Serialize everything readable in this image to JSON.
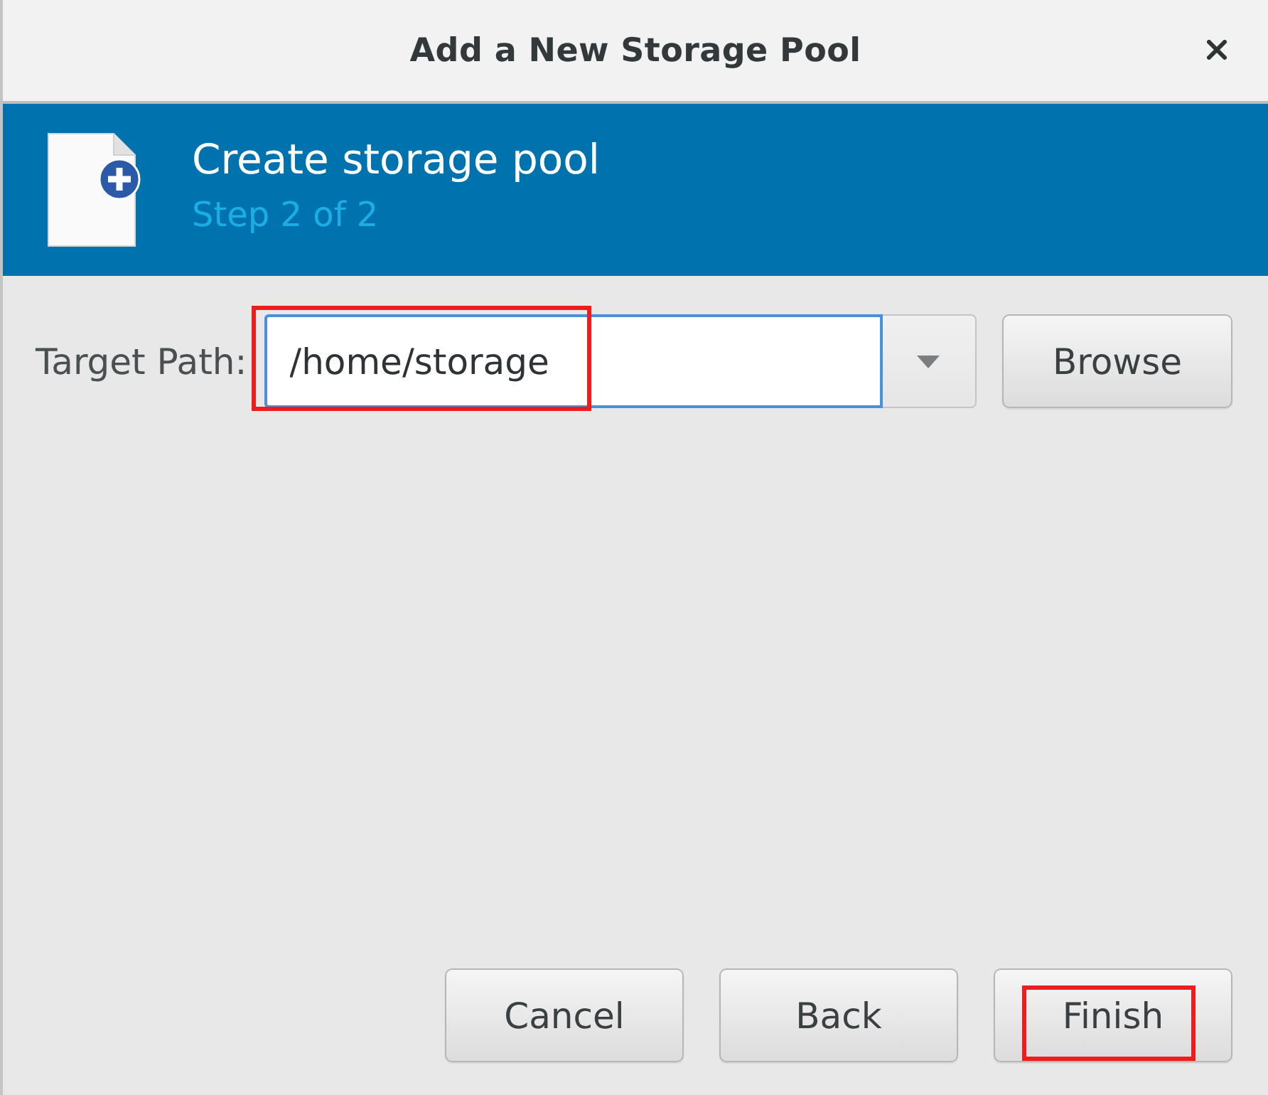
{
  "window": {
    "title": "Add a New Storage Pool"
  },
  "header": {
    "title": "Create storage pool",
    "subtitle": "Step 2 of 2"
  },
  "target_path": {
    "label": "Target Path:",
    "value": "/home/storage",
    "focused": true,
    "highlighted": true
  },
  "browse_button": {
    "label": "Browse"
  },
  "buttons": [
    {
      "label": "Cancel",
      "highlighted": false
    },
    {
      "label": "Back",
      "highlighted": false
    },
    {
      "label": "Finish",
      "highlighted": true
    }
  ]
}
